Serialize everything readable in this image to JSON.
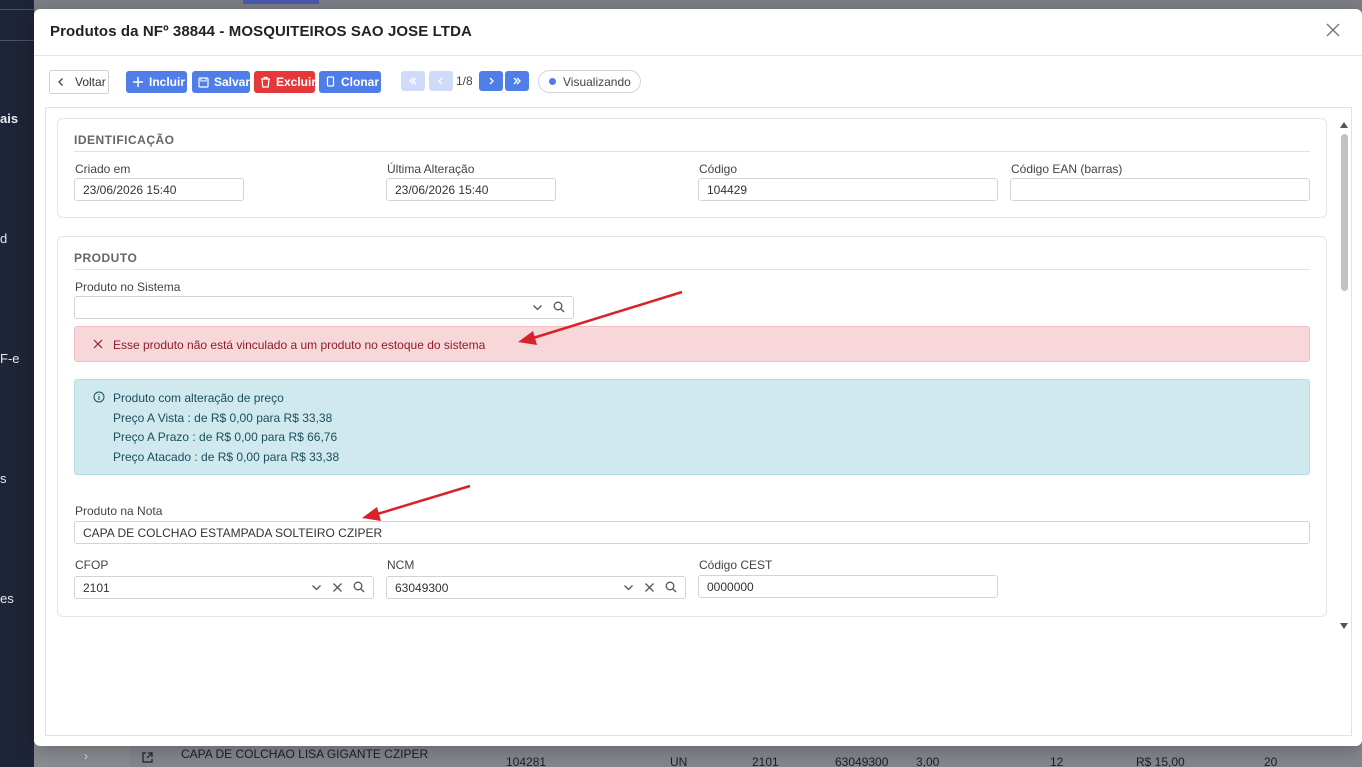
{
  "background": {
    "sidebar_fragments": [
      "ais",
      "d",
      "F-e",
      "s",
      "es"
    ],
    "row": {
      "product": "CAPA DE COLCHAO LISA GIGANTE CZIPER",
      "code": "104281",
      "unit": "UN",
      "cfop": "2101",
      "ncm": "63049300",
      "qty": "3,00",
      "qty2": "12",
      "price": "R$ 15,00",
      "last": "20"
    }
  },
  "modal": {
    "title": "Produtos da NFº 38844 - MOSQUITEIROS SAO JOSE LTDA",
    "toolbar": {
      "voltar": "Voltar",
      "incluir": "Incluir",
      "salvar": "Salvar",
      "excluir": "Excluir",
      "clonar": "Clonar",
      "page": "1/8",
      "status": "Visualizando"
    },
    "identificacao": {
      "title": "IDENTIFICAÇÃO",
      "criado_label": "Criado em",
      "criado_value": "23/06/2026 15:40",
      "alteracao_label": "Última Alteração",
      "alteracao_value": "23/06/2026 15:40",
      "codigo_label": "Código",
      "codigo_value": "104429",
      "ean_label": "Código EAN (barras)",
      "ean_value": ""
    },
    "produto": {
      "title": "PRODUTO",
      "sistema_label": "Produto no Sistema",
      "sistema_value": "",
      "alert_danger": "Esse produto não está vinculado a um produto no estoque do sistema",
      "alert_info": {
        "title": "Produto com alteração de preço",
        "lines": [
          "Preço A Vista : de R$ 0,00 para R$ 33,38",
          "Preço A Prazo : de R$ 0,00 para R$ 66,76",
          "Preço Atacado : de R$ 0,00 para R$ 33,38"
        ]
      },
      "nota_label": "Produto na Nota",
      "nota_value": "CAPA DE COLCHAO ESTAMPADA SOLTEIRO CZIPER",
      "cfop_label": "CFOP",
      "cfop_value": "2101",
      "ncm_label": "NCM",
      "ncm_value": "63049300",
      "cest_label": "Código CEST",
      "cest_value": "0000000"
    }
  },
  "colors": {
    "primary": "#4f7ee8",
    "danger": "#e5383b",
    "alert_danger_bg": "#f8d7da",
    "alert_info_bg": "#cfe9ee",
    "annotation_arrow": "#d9232a",
    "sidebar": "#1f2538"
  }
}
